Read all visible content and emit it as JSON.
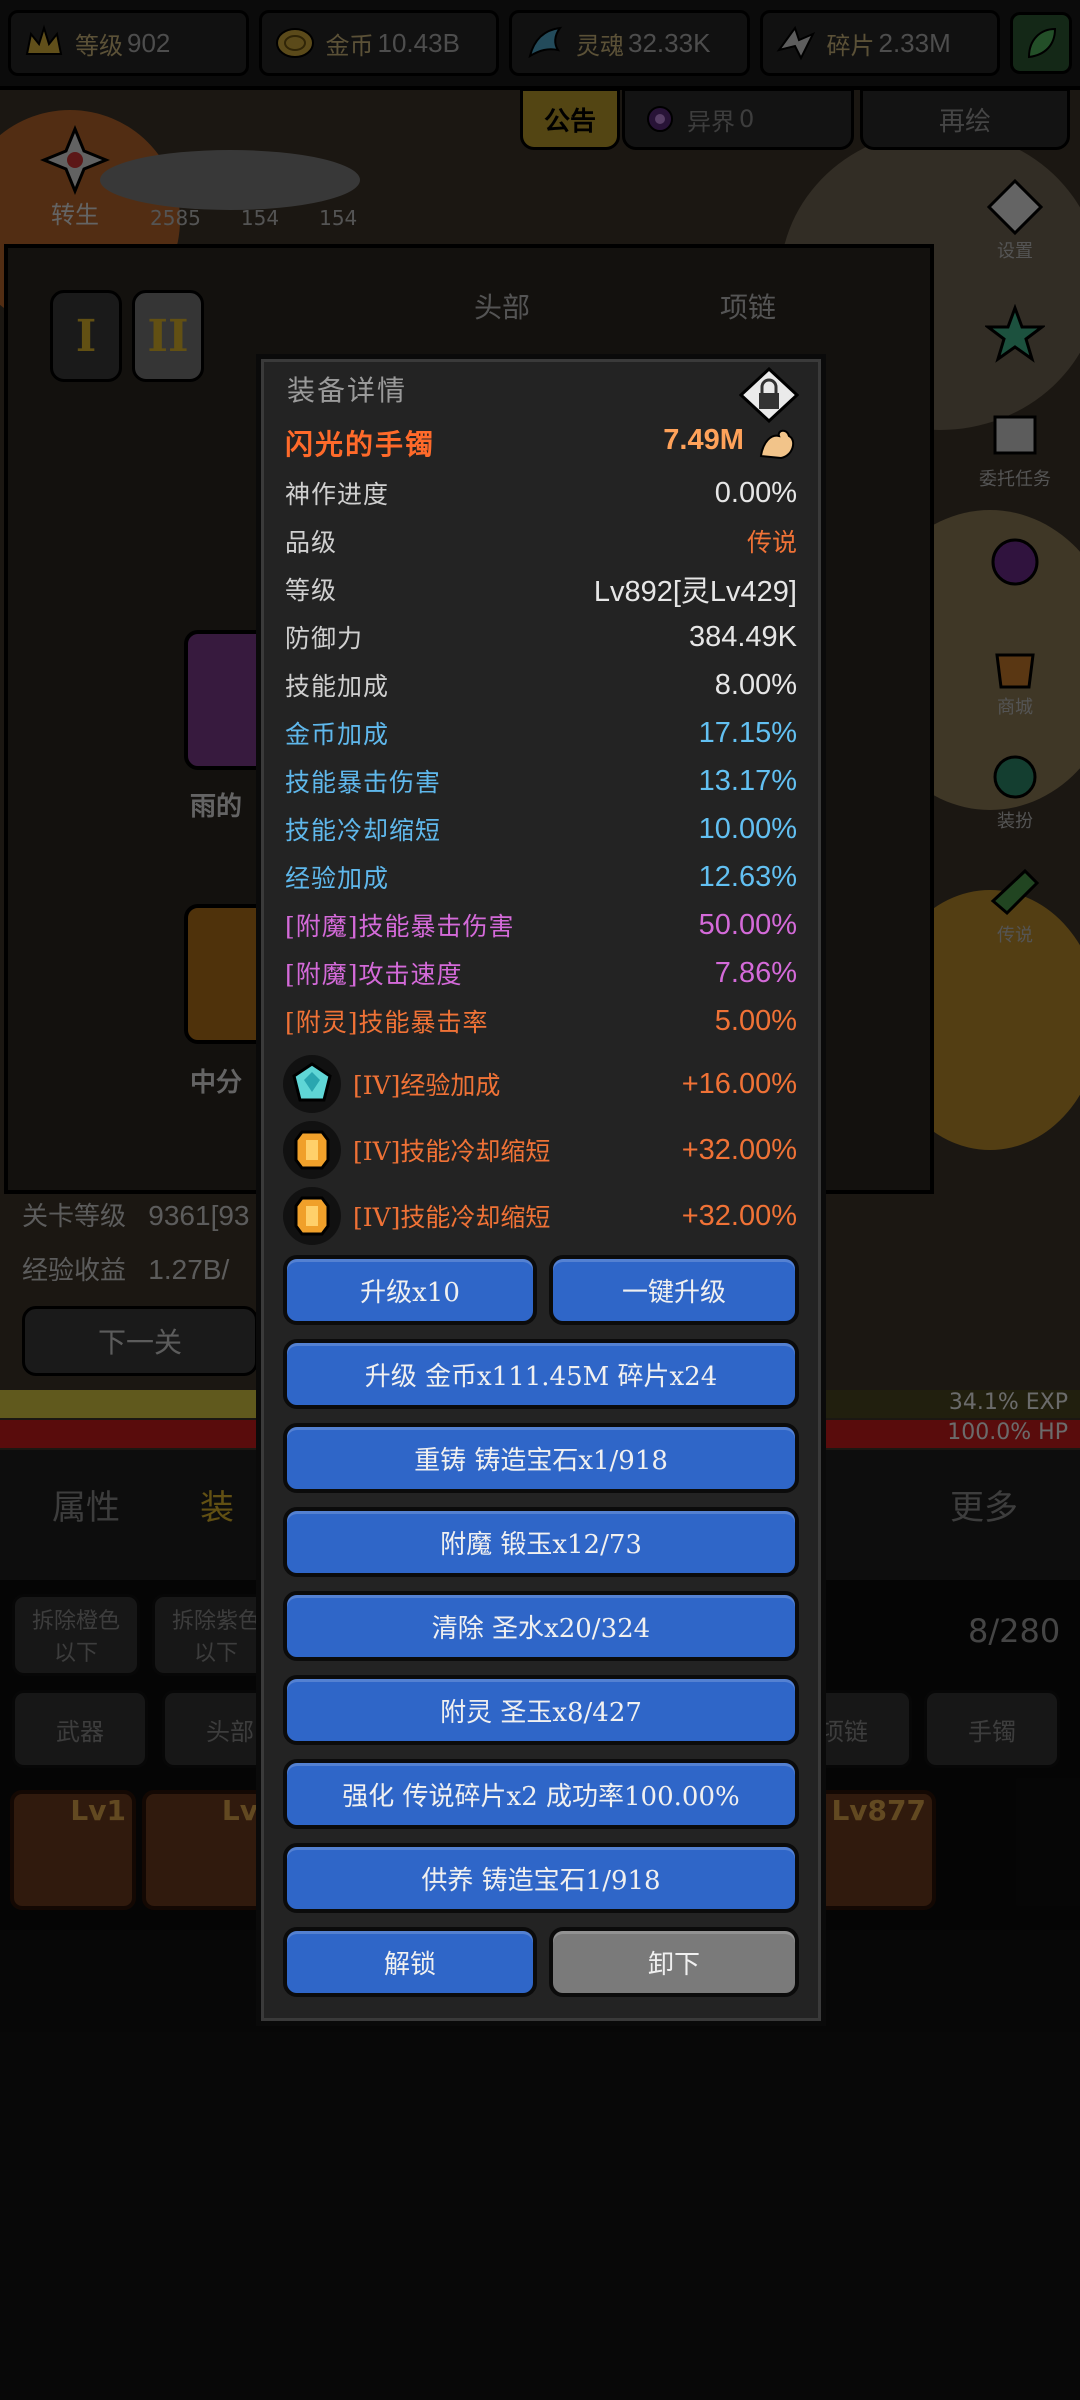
{
  "resources": [
    {
      "label": "等级",
      "value": "902",
      "icon": "crown-icon"
    },
    {
      "label": "金币",
      "value": "10.43B",
      "icon": "coin-icon"
    },
    {
      "label": "灵魂",
      "value": "32.33K",
      "icon": "soul-icon"
    },
    {
      "label": "碎片",
      "value": "2.33M",
      "icon": "shard-icon"
    }
  ],
  "top_tabs": {
    "notice": "公告",
    "realm_label": "异界",
    "realm_value": "0",
    "redraw": "再绘"
  },
  "background": {
    "reincarnate": "转生",
    "mini_values": [
      "2585",
      "154",
      "154"
    ],
    "roman_1": "I",
    "roman_2": "II",
    "head_slot": "头部",
    "necklace_slot": "项链",
    "item_name_1": "雨的",
    "item_name_2": "中分",
    "stage_level_label": "关卡等级",
    "stage_level_value": "9361[93",
    "exp_income_label": "经验收益",
    "exp_income_value": "1.27B/",
    "next_stage": "下一关",
    "exp_percent": "34.1% EXP",
    "hp_percent": "100.0%  HP",
    "side_labels": [
      "设置",
      "",
      "委托任务",
      "",
      "商城",
      "装扮",
      "传说"
    ],
    "bottom_tabs": [
      "属性",
      "装",
      "更多"
    ],
    "filters": [
      "拆除橙色\n以下",
      "拆除紫色\n以下"
    ],
    "capacity": "8/280",
    "slot_categories": [
      "武器",
      "头部",
      "项链",
      "手镯"
    ],
    "item_levels": [
      "Lv1",
      "Lv",
      "Lv877"
    ]
  },
  "modal": {
    "title": "装备详情",
    "item_name": "闪光的手镯",
    "power": "7.49M",
    "stats": [
      {
        "key": "神作进度",
        "value": "0.00%",
        "color": "white"
      },
      {
        "key": "品级",
        "value": "传说",
        "color": "white-orange"
      },
      {
        "key": "等级",
        "value": "Lv892[灵Lv429]",
        "color": "white"
      },
      {
        "key": "防御力",
        "value": "384.49K",
        "color": "white"
      },
      {
        "key": "技能加成",
        "value": "8.00%",
        "color": "white"
      },
      {
        "key": "金币加成",
        "value": "17.15%",
        "color": "blue"
      },
      {
        "key": "技能暴击伤害",
        "value": "13.17%",
        "color": "blue"
      },
      {
        "key": "技能冷却缩短",
        "value": "10.00%",
        "color": "blue"
      },
      {
        "key": "经验加成",
        "value": "12.63%",
        "color": "blue"
      },
      {
        "key": "[附魔]技能暴击伤害",
        "value": "50.00%",
        "color": "purple"
      },
      {
        "key": "[附魔]攻击速度",
        "value": "7.86%",
        "color": "purple"
      },
      {
        "key": "[附灵]技能暴击率",
        "value": "5.00%",
        "color": "orange"
      }
    ],
    "gems": [
      {
        "key": "[IV]经验加成",
        "value": "+16.00%",
        "icon": "diamond-gem-icon"
      },
      {
        "key": "[IV]技能冷却缩短",
        "value": "+32.00%",
        "icon": "amber-gem-icon"
      },
      {
        "key": "[IV]技能冷却缩短",
        "value": "+32.00%",
        "icon": "amber-gem-icon"
      }
    ],
    "buttons": {
      "upgrade10": "升级x10",
      "upgrade_all": "一键升级",
      "upgrade_cost": "升级 金币x111.45M 碎片x24",
      "recast": "重铸 铸造宝石x1/918",
      "enchant": "附魔 锻玉x12/73",
      "cleanse": "清除 圣水x20/324",
      "spirit": "附灵 圣玉x8/427",
      "enhance": "强化 传说碎片x2 成功率100.00%",
      "offer": "供养 铸造宝石1/918",
      "unlock": "解锁",
      "unequip": "卸下"
    },
    "colors": {
      "accent_orange": "#f07236",
      "blue": "#62c0f2",
      "purple": "#d46ad9",
      "button_blue": "#2f66c8"
    }
  }
}
